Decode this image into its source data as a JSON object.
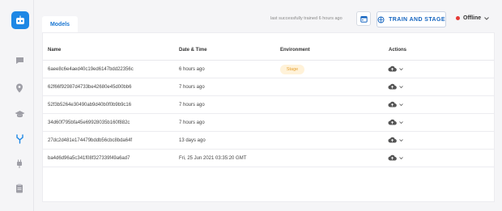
{
  "sidebar": {
    "logo_icon": "robot-icon",
    "items": [
      {
        "icon": "chat-icon"
      },
      {
        "icon": "location-pin-icon"
      },
      {
        "icon": "graduation-cap-icon"
      },
      {
        "icon": "model-branch-icon",
        "active": true
      },
      {
        "icon": "plug-icon"
      },
      {
        "icon": "clipboard-icon"
      }
    ]
  },
  "header": {
    "tab_models": "Models",
    "last_trained": "last successfully trained 6 hours ago",
    "train_button": "TRAIN AND STAGE",
    "status": "Offline",
    "status_color": "#e53935"
  },
  "table": {
    "columns": [
      "Name",
      "Date & Time",
      "Environment",
      "Actions"
    ],
    "rows": [
      {
        "name": "6aee8c6e4aed40c19ed6147bdd22356c",
        "date": "6 hours ago",
        "environment": "Stage"
      },
      {
        "name": "62f66f92987d4733be42680e45d00bb6",
        "date": "7 hours ago",
        "environment": ""
      },
      {
        "name": "52f3b5264e30490ab9d40b0f0b9b9c16",
        "date": "7 hours ago",
        "environment": ""
      },
      {
        "name": "34d60f795bfa45e69928035b160f882c",
        "date": "7 hours ago",
        "environment": ""
      },
      {
        "name": "27dc2d481e174479bddb56cbc8bda64f",
        "date": "13 days ago",
        "environment": ""
      },
      {
        "name": "ba4d6d96a5c341f08f327339f49a6ad7",
        "date": "Fri, 25 Jun 2021 03:35:20 GMT",
        "environment": ""
      }
    ]
  },
  "colors": {
    "accent": "#1976d2",
    "badge_bg": "#fff2d9",
    "badge_text": "#e6a030"
  }
}
